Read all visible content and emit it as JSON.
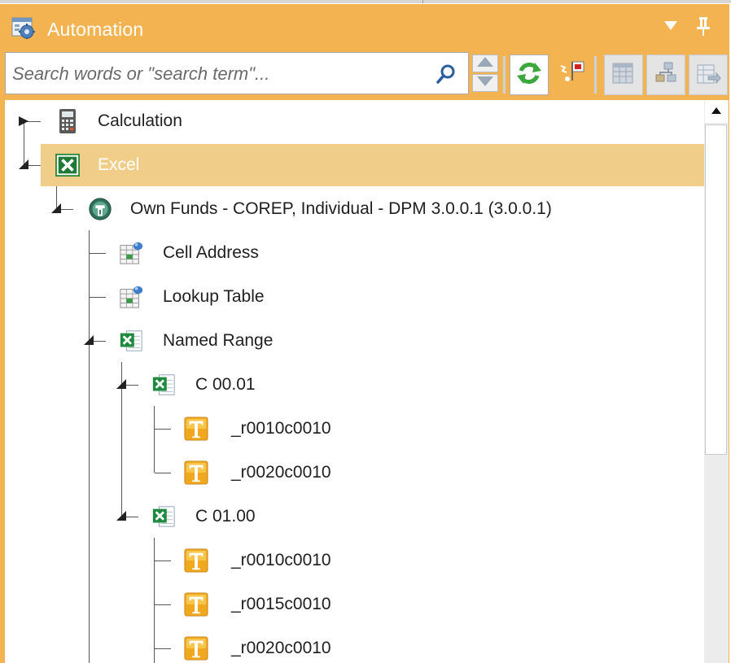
{
  "panel": {
    "title": "Automation",
    "title_icon": "automation-gear-icon",
    "dropdown_icon": "triangle-down-icon",
    "pin_icon": "pin-icon"
  },
  "toolbar": {
    "search_placeholder": "Search words or \"search term\"...",
    "search_value": "",
    "buttons": [
      {
        "name": "refresh-button",
        "icon": "refresh-icon"
      },
      {
        "name": "flag-button",
        "icon": "flag-icon",
        "active": true
      },
      {
        "name": "grid-button",
        "icon": "grid-icon"
      },
      {
        "name": "tree-button",
        "icon": "tree-icon"
      },
      {
        "name": "export-button",
        "icon": "export-icon"
      }
    ]
  },
  "tree": {
    "nodes": [
      {
        "label": "Calculation",
        "icon": "calculator-icon"
      },
      {
        "label": "Excel",
        "icon": "excel-icon",
        "selected": true
      },
      {
        "label": "Own Funds - COREP, Individual - DPM 3.0.0.1 (3.0.0.1)",
        "icon": "module-icon"
      },
      {
        "label": "Cell Address",
        "icon": "table-cell-icon"
      },
      {
        "label": "Lookup Table",
        "icon": "table-cell-icon"
      },
      {
        "label": "Named Range",
        "icon": "excel-sheet-icon"
      },
      {
        "label": "C 00.01",
        "icon": "excel-sheet-icon"
      },
      {
        "label": "_r0010c0010",
        "icon": "text-t-icon"
      },
      {
        "label": "_r0020c0010",
        "icon": "text-t-icon"
      },
      {
        "label": "C 01.00",
        "icon": "excel-sheet-icon"
      },
      {
        "label": "_r0010c0010",
        "icon": "text-t-icon"
      },
      {
        "label": "_r0015c0010",
        "icon": "text-t-icon"
      },
      {
        "label": "_r0020c0010",
        "icon": "text-t-icon"
      }
    ]
  },
  "colors": {
    "accent": "#f2b350",
    "selected_row": "#f0cd88"
  }
}
